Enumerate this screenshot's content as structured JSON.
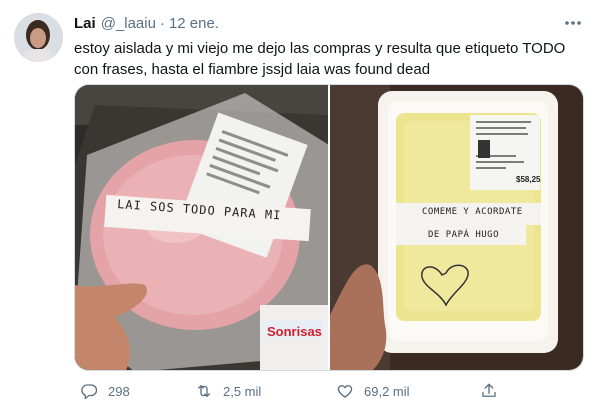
{
  "tweet": {
    "author_name": "Lai",
    "handle": "@_laaiu",
    "separator": "·",
    "date": "12 ene.",
    "text": "estoy aislada y mi viejo me dejo las compras y resulta que etiqueto TODO con frases, hasta el fiambre jssjd laia was found dead",
    "more_icon": "more-horizontal-icon",
    "photos": [
      {
        "label_text": "LAI SOS TODO PARA MI",
        "package_brand": "Sonrisas"
      },
      {
        "label_line1": "COMEME Y ACORDATE",
        "label_line2": "DE PAPÁ HUGO",
        "price": "$58,25"
      }
    ],
    "actions": {
      "reply_count": "298",
      "retweet_count": "2,5 mil",
      "like_count": "69,2 mil"
    }
  },
  "colors": {
    "text": "#0f1419",
    "secondary": "#5b7083",
    "border": "#cfd9de"
  }
}
